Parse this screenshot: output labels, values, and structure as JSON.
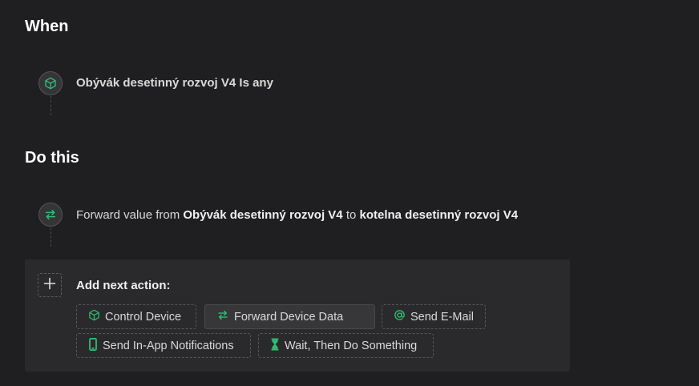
{
  "when": {
    "title": "When",
    "trigger": {
      "icon": "cube-icon",
      "text": "Obývák desetinný rozvoj V4 Is any"
    }
  },
  "do_this": {
    "title": "Do this",
    "action": {
      "icon": "arrows-exchange-icon",
      "prefix": "Forward value from",
      "source": "Obývák desetinný rozvoj V4",
      "connector": "to",
      "target": "kotelna desetinný rozvoj V4"
    }
  },
  "next_action": {
    "label": "Add next action:",
    "plus_icon": "plus-icon",
    "options": [
      {
        "label": "Control Device",
        "icon": "cube-icon"
      },
      {
        "label": "Forward Device Data",
        "icon": "arrows-exchange-icon"
      },
      {
        "label": "Send E-Mail",
        "icon": "at-sign-icon"
      },
      {
        "label": "Send In-App Notifications",
        "icon": "phone-icon"
      },
      {
        "label": "Wait, Then Do Something",
        "icon": "hourglass-icon"
      }
    ]
  },
  "colors": {
    "accent": "#2fbf71",
    "background": "#1f1f21",
    "panel": "#2a2a2d"
  }
}
